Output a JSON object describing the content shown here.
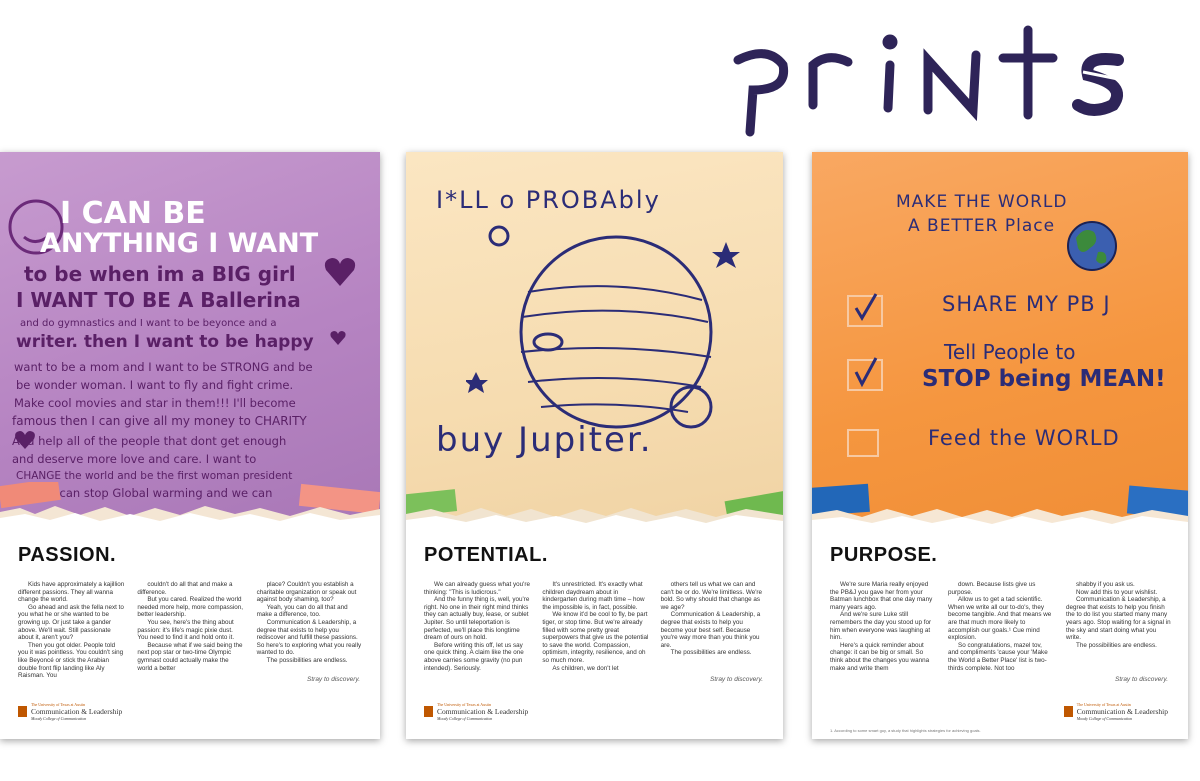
{
  "header": {
    "title": "Prints"
  },
  "posters": [
    {
      "art_lines": [
        "I CAN BE",
        "ANYTHING I WANT",
        "to be when im a BIG girl",
        "I WANT TO BE A Ballerina",
        "and do gymnastics and I want to be beyonce and a",
        "writer. then I want to be happy",
        "want to be a mom and I want to be STRONG and be",
        "be wonder woman. I want to fly and fight crime.",
        "Make cool movies and star in them!!! I'll become",
        "famous then I can give all my money to CHARITY",
        "And help all of the people that dont get enough",
        "and deserve more love and care. I want to",
        "CHANGE the world and be the first woman president",
        "so i can stop Global warming and we can"
      ],
      "heading": "PASSION.",
      "columns": [
        [
          "Kids have approximately a kajillion different passions. They all wanna change the world.",
          "Go ahead and ask the fella next to you what he or she wanted to be growing up. Or just take a gander above. We'll wait. Still passionate about it, aren't you?",
          "Then you got older. People told you it was pointless. You couldn't sing like Beyoncé or stick the Arabian double front flip landing like Aly Raisman. You"
        ],
        [
          "couldn't do all that and make a difference.",
          "But you cared. Realized the world needed more help, more compassion, better leadership.",
          "You see, here's the thing about passion: it's life's magic pixie dust. You need to find it and hold onto it.",
          "Because what if we said being the next pop star or two-time Olympic gymnast could actually make the world a better"
        ],
        [
          "place? Couldn't you establish a charitable organization or speak out against body shaming, too?",
          "Yeah, you can do all that and make a difference, too.",
          "Communication & Leadership, a degree that exists to help you rediscover and fulfill these passions. So here's to exploring what you really wanted to do.",
          "The possibilities are endless."
        ]
      ],
      "signoff": "Stray to discovery.",
      "footnote": ""
    },
    {
      "art_lines": [
        "I*LL o PROBAbly",
        "buy Jupiter."
      ],
      "heading": "POTENTIAL.",
      "columns": [
        [
          "We can already guess what you're thinking: \"This is ludicrous.\"",
          "And the funny thing is, well, you're right. No one in their right mind thinks they can actually buy, lease, or sublet Jupiter. So until teleportation is perfected, we'll place this longtime dream of ours on hold.",
          "Before writing this off, let us say one quick thing. A claim like the one above carries some gravity (no pun intended). Seriously."
        ],
        [
          "It's unrestricted. It's exactly what children daydream about in kindergarten during math time – how the impossible is, in fact, possible.",
          "We know it'd be cool to fly, be part tiger, or stop time. But we're already filled with some pretty great superpowers that give us the potential to save the world. Compassion, optimism, integrity, resilience, and oh so much more.",
          "As children, we don't let"
        ],
        [
          "others tell us what we can and can't be or do. We're limitless. We're bold. So why should that change as we age?",
          "Communication & Leadership, a degree that exists to help you become your best self. Because you're way more than you think you are.",
          "The possibilities are endless."
        ]
      ],
      "signoff": "Stray to discovery.",
      "footnote": ""
    },
    {
      "art_lines": [
        "MAKE THE WORLD",
        "A BETTER Place",
        "SHARE MY PB J",
        "Tell People to",
        "STOP being MEAN!",
        "Feed the WORLD"
      ],
      "heading": "PURPOSE.",
      "columns": [
        [
          "We're sure Maria really enjoyed the PB&J you gave her from your Batman lunchbox that one day many many years ago.",
          "And we're sure Luke still remembers the day you stood up for him when everyone was laughing at him.",
          "Here's a quick reminder about change: it can be big or small. So think about the changes you wanna make and write them"
        ],
        [
          "down. Because lists give us purpose.",
          "Allow us to get a tad scientific. When we write all our to-do's, they become tangible. And that means we are that much more likely to accomplish our goals.¹ Cue mind explosion.",
          "So congratulations, mazel tov, and compliments 'cause your 'Make the World a Better Place' list is two-thirds complete. Not too"
        ],
        [
          "shabby if you ask us.",
          "Now add this to your wishlist.",
          "Communication & Leadership, a degree that exists to help you finish the to do list you started many many years ago. Stop waiting for a signal in the sky and start doing what you write.",
          "The possibilities are endless."
        ]
      ],
      "signoff": "Stray to discovery.",
      "footnote": "1. According to some smart guy, a study that highlights strategies for achieving goals."
    }
  ],
  "logo": {
    "line1": "The University of Texas at Austin",
    "line2": "Communication & Leadership",
    "line3": "Moody College of Communication"
  },
  "colors": {
    "purple": "#b684c2",
    "cream": "#f6dcb0",
    "orange": "#f5963f",
    "ink": "#2b2c77"
  }
}
